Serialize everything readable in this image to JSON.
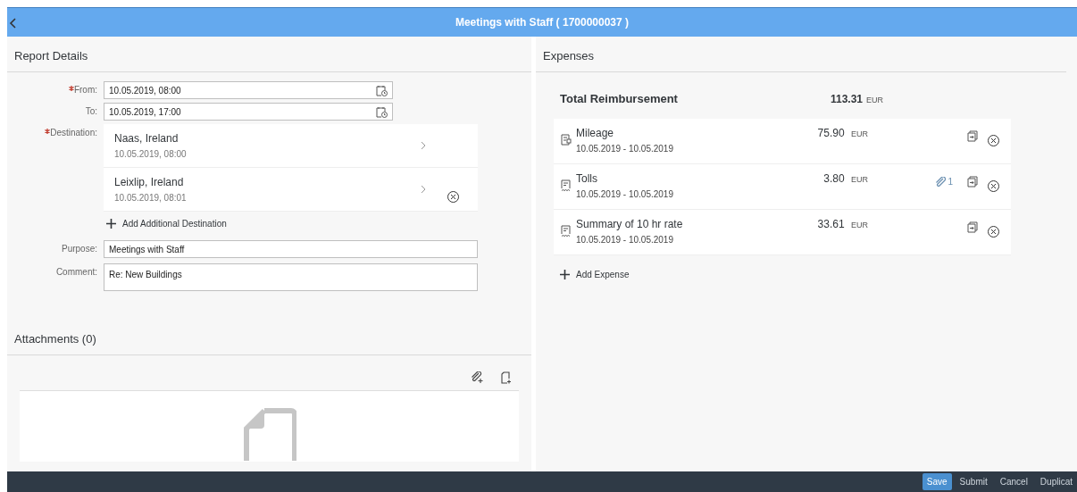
{
  "header": {
    "title": "Meetings with Staff ( 1700000037 )"
  },
  "report_details": {
    "title": "Report Details",
    "fields": [
      {
        "label": "From:",
        "required": true,
        "kind": "datetime",
        "value": "10.05.2019, 08:00"
      },
      {
        "label": "To:",
        "required": false,
        "kind": "datetime",
        "value": "10.05.2019, 17:00"
      },
      {
        "label": "Destination:",
        "required": true,
        "kind": "destinations",
        "destinations": [
          {
            "name": "Naas, Ireland",
            "time": "10.05.2019, 08:00",
            "removable": false
          },
          {
            "name": "Leixlip, Ireland",
            "time": "10.05.2019, 08:01",
            "removable": true
          }
        ],
        "add_label": "Add Additional Destination"
      },
      {
        "label": "Purpose:",
        "required": false,
        "kind": "text",
        "value": "Meetings with Staff"
      },
      {
        "label": "Comment:",
        "required": false,
        "kind": "textarea",
        "value": "Re: New Buildings"
      }
    ]
  },
  "attachments": {
    "title": "Attachments (0)"
  },
  "expenses": {
    "title": "Expenses",
    "total_label": "Total Reimbursement",
    "total_amount": "113.31",
    "total_currency": "EUR",
    "items": [
      {
        "kind": "mileage",
        "name": "Mileage",
        "dates": "10.05.2019 - 10.05.2019",
        "amount": "75.90",
        "currency": "EUR"
      },
      {
        "kind": "receipt",
        "name": "Tolls",
        "dates": "10.05.2019 - 10.05.2019",
        "amount": "3.80",
        "currency": "EUR",
        "attachment_count": "1"
      },
      {
        "kind": "receipt",
        "name": "Summary of 10 hr rate",
        "dates": "10.05.2019 - 10.05.2019",
        "amount": "33.61",
        "currency": "EUR"
      }
    ],
    "add_label": "Add Expense"
  },
  "footer": {
    "buttons": [
      {
        "label": "Save",
        "emphasized": true
      },
      {
        "label": "Submit",
        "emphasized": false
      },
      {
        "label": "Cancel",
        "emphasized": false
      },
      {
        "label": "Duplicat",
        "emphasized": false
      }
    ]
  }
}
